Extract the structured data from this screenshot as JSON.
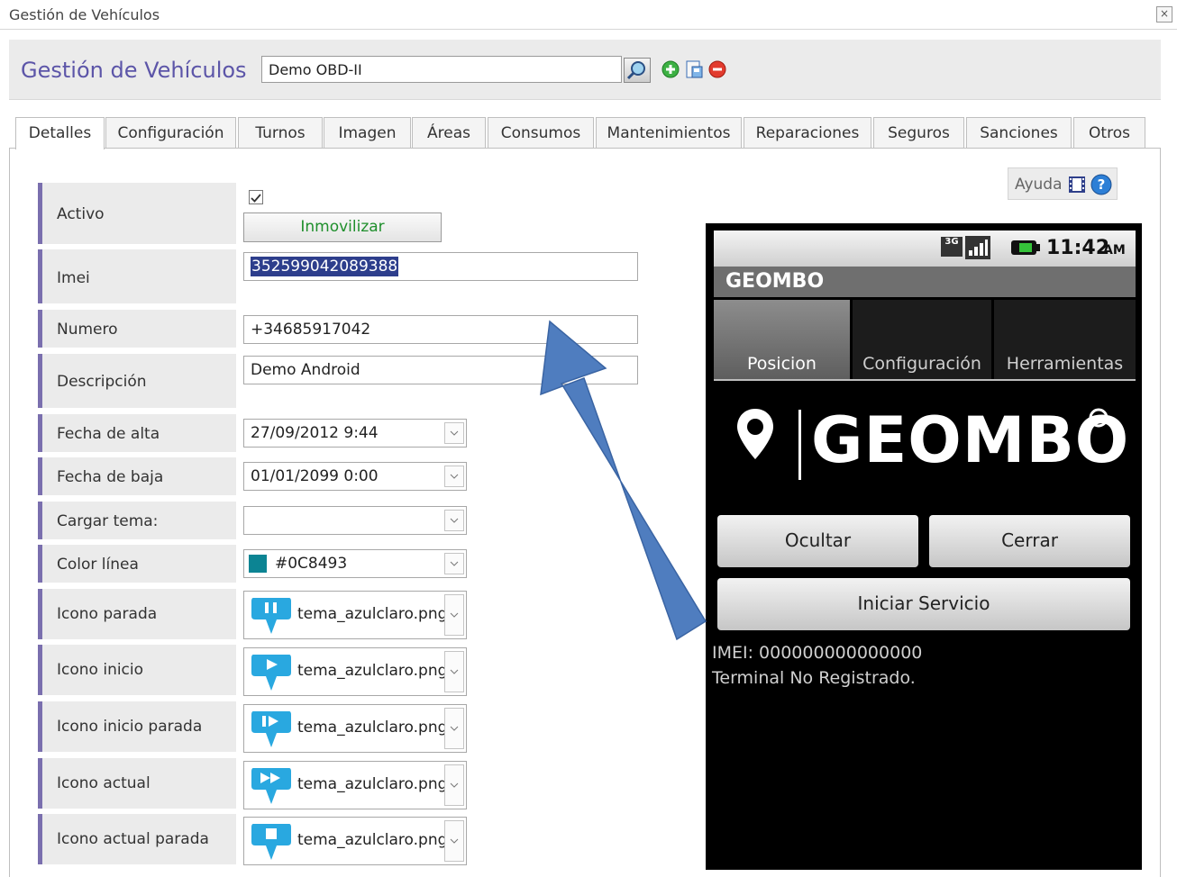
{
  "window": {
    "title": "Gestión de Vehículos",
    "close_glyph": "×"
  },
  "header": {
    "title": "Gestión de Vehículos",
    "vehicle_value": "Demo OBD-II"
  },
  "tabs": [
    "Detalles",
    "Configuración",
    "Turnos",
    "Imagen",
    "Áreas",
    "Consumos",
    "Mantenimientos",
    "Reparaciones",
    "Seguros",
    "Sanciones",
    "Otros"
  ],
  "help": {
    "label": "Ayuda"
  },
  "form": {
    "activo_label": "Activo",
    "inmovilizar_label": "Inmovilizar",
    "imei_label": "Imei",
    "imei_value": "352599042089388",
    "numero_label": "Numero",
    "numero_value": "+34685917042",
    "descripcion_label": "Descripción",
    "descripcion_value": "Demo Android",
    "fecha_alta_label": "Fecha de alta",
    "fecha_alta_value": "27/09/2012 9:44",
    "fecha_baja_label": "Fecha de baja",
    "fecha_baja_value": "01/01/2099 0:00",
    "cargar_tema_label": "Cargar tema:",
    "cargar_tema_value": "",
    "color_linea_label": "Color línea",
    "color_linea_value": "#0C8493",
    "icons": [
      {
        "label": "Icono parada",
        "value": "tema_azulclaro.png",
        "glyph": "pause"
      },
      {
        "label": "Icono inicio",
        "value": "tema_azulclaro.png",
        "glyph": "play"
      },
      {
        "label": "Icono inicio parada",
        "value": "tema_azulclaro.png",
        "glyph": "pause-play"
      },
      {
        "label": "Icono actual",
        "value": "tema_azulclaro.png",
        "glyph": "fast-forward"
      },
      {
        "label": "Icono actual parada",
        "value": "tema_azulclaro.png",
        "glyph": "stop"
      }
    ]
  },
  "phone": {
    "status_time": "11:42",
    "status_ampm": "AM",
    "network": "3G",
    "app_title": "GEOMBO",
    "tabs": [
      "Posicion",
      "Configuración",
      "Herramientas"
    ],
    "logo_text": "GEOMBO",
    "ocultar_label": "Ocultar",
    "cerrar_label": "Cerrar",
    "iniciar_label": "Iniciar Servicio",
    "imei_line": "IMEI: 000000000000000",
    "status_line": "Terminal No Registrado."
  },
  "colors": {
    "accent": "#5c55a8",
    "label_bar": "#7a6fae",
    "line_color": "#0C8493",
    "arrow": "#4f7dbf",
    "pin": "#29a8e0"
  }
}
